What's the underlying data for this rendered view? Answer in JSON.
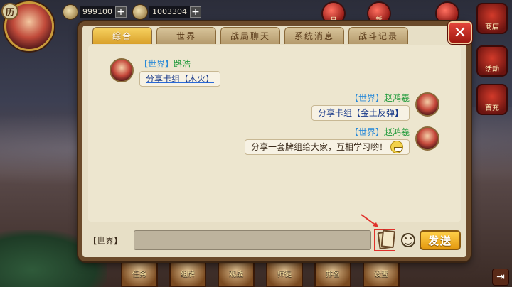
{
  "hud": {
    "resource_1_value": "999100",
    "resource_2_value": "1003304",
    "plus_symbol": "+",
    "avatar_badge": "历",
    "top_icons": [
      "日",
      "新",
      ""
    ],
    "side_icons": [
      "商店",
      "活动",
      "首充"
    ],
    "bottom_icons": [
      "任务",
      "组牌",
      "观战",
      "师徒",
      "排名",
      "设置"
    ]
  },
  "dialog": {
    "tabs": [
      {
        "label": "综合",
        "active": true
      },
      {
        "label": "世界",
        "active": false
      },
      {
        "label": "战局聊天",
        "active": false
      },
      {
        "label": "系统消息",
        "active": false
      },
      {
        "label": "战斗记录",
        "active": false
      }
    ],
    "close_symbol": "✕",
    "messages": [
      {
        "side": "left",
        "channel": "【世界】",
        "sender": "路浩",
        "text": "分享卡组【木火】",
        "is_link": true
      },
      {
        "side": "right",
        "channel": "【世界】",
        "sender": "赵鸿羲",
        "text": "分享卡组【金土反弹】",
        "is_link": true
      },
      {
        "side": "right",
        "channel": "【世界】",
        "sender": "赵鸿羲",
        "text": "分享一套牌组给大家，互相学习哟！",
        "is_link": false,
        "emoji": "grin"
      }
    ],
    "input": {
      "channel_label": "【世界】",
      "value": "",
      "placeholder": ""
    },
    "send_label": "发送"
  },
  "colors": {
    "dialog_bg": "#e7dfc6",
    "tab_active": "#f7d260",
    "channel_blue": "#2a8ad8",
    "sender_green": "#1f9a3a",
    "send_button": "#ffd04a",
    "close_button": "#e4453a"
  }
}
